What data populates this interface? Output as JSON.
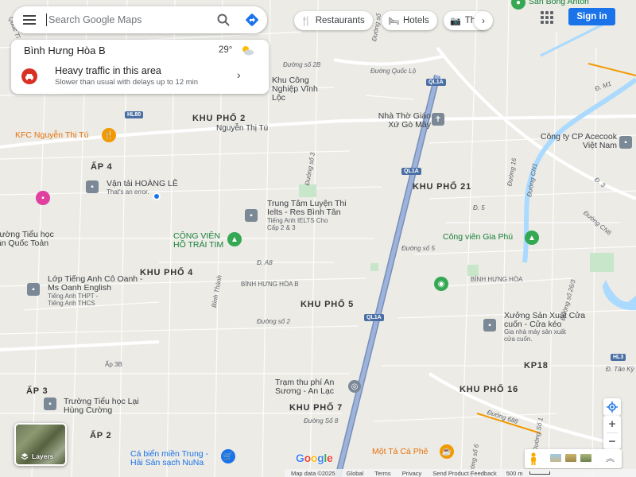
{
  "search": {
    "placeholder": "Search Google Maps"
  },
  "chips": [
    {
      "icon": "fork-knife-icon",
      "label": "Restaurants"
    },
    {
      "icon": "bed-icon",
      "label": "Hotels"
    },
    {
      "icon": "camera-icon",
      "label": "Th"
    }
  ],
  "header": {
    "signin_label": "Sign in"
  },
  "info_card": {
    "place": "Bình Hưng Hòa B",
    "temperature": "29°",
    "traffic_title": "Heavy traffic in this area",
    "traffic_subtitle": "Slower than usual with delays up to 12 min"
  },
  "layers": {
    "label": "Layers"
  },
  "logo": {
    "text": "Google"
  },
  "footer": {
    "map_data": "Map data ©2025",
    "global": "Global",
    "terms": "Terms",
    "privacy": "Privacy",
    "feedback": "Send Product Feedback",
    "scale": "500 m"
  },
  "colors": {
    "accent": "#1a73e8",
    "traffic_red": "#d93025",
    "highway": "#8fa7cf",
    "park": "#c8e6c9",
    "water": "#aadaff"
  },
  "map": {
    "areas": [
      "KHU PHỐ 2",
      "KHU PHỐ 21",
      "KHU PHỐ 4",
      "KHU PHỐ 5",
      "KHU PHỐ 7",
      "KHU PHỐ 16",
      "KP18",
      "ẤP 4",
      "ẤP 3",
      "ẤP 2",
      "Ấp 3B",
      "BÌNH HƯNG HÒA B",
      "BÌNH HƯNG HÒA"
    ],
    "streets": [
      "Nguyễn Thị Tú",
      "Đường số 2B",
      "Đường Quốc Lộ",
      "Đường số 3",
      "Đường số 5",
      "Đường số 2",
      "Đường Số 8",
      "Đường 688",
      "Đường Số 1",
      "Đường CN1",
      "Đường CN6",
      "Đường 16",
      "Đường số 26/3",
      "Bình Thành",
      "Đ. A8",
      "Quốc Tỉ",
      "Đ. M1",
      "Đ. 3",
      "Đ. Tân Kỳ",
      "Đường số",
      "Đ. 5",
      "Đường số 6"
    ],
    "shields": [
      "QL1A",
      "QL1A",
      "QL1A",
      "HL80",
      "HL3"
    ],
    "pois": [
      {
        "name": "Sân Bóng Anton"
      },
      {
        "name": "Khu Công Nghiệp Vĩnh Lộc"
      },
      {
        "name": "Nhà Thờ Giáo Xứ Gò Mây"
      },
      {
        "name": "Công ty CP Acecook Việt Nam"
      },
      {
        "name": "KFC Nguyễn Thị Tú"
      },
      {
        "name": "Vận tải HOÀNG LÊ",
        "sub": "That's an error."
      },
      {
        "name": "Trung Tâm Luyện Thi Ielts - Res Bình Tân",
        "sub": "Tiếng Anh IELTS Cho Cấp 2 & 3"
      },
      {
        "name": "CÔNG VIÊN HỒ TRÁI TIM"
      },
      {
        "name": "Trường Tiểu học Lân Quốc Toản"
      },
      {
        "name": "Công viên Gia Phú"
      },
      {
        "name": "Lớp Tiếng Anh Cô Oanh - Ms Oanh English",
        "sub": "Tiếng Anh THPT - Tiếng Anh THCS"
      },
      {
        "name": "Xưởng Sản Xuất Cửa cuốn - Cửa kéo",
        "sub": "Gia nhà máy sản xuất cửa cuốn."
      },
      {
        "name": "Trạm thu phí An Sương - An Lạc"
      },
      {
        "name": "Trường Tiểu học Lại Hùng Cường"
      },
      {
        "name": "Cá biển miền Trung - Hải Sản sạch NuNa"
      },
      {
        "name": "Một Tá Cà Phê"
      }
    ]
  }
}
